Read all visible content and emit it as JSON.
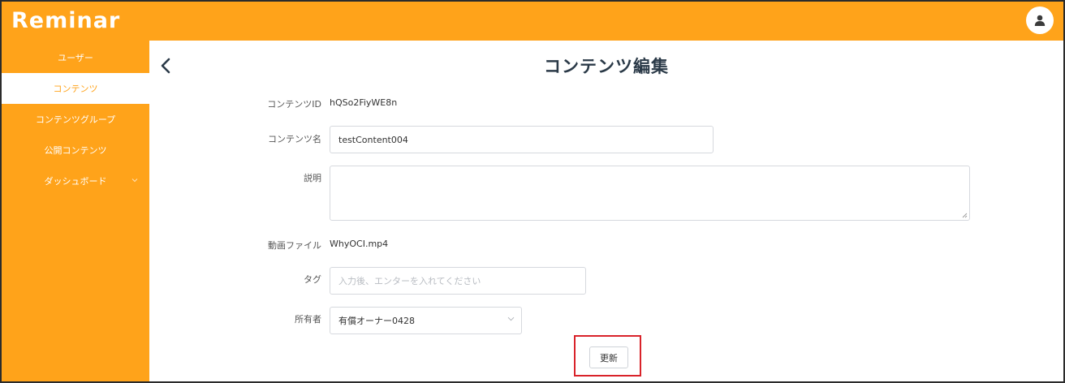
{
  "header": {
    "logo": "Reminar",
    "user_icon": "user-avatar-icon",
    "color": "#ffa31a"
  },
  "sidebar": {
    "items": [
      {
        "label": "ユーザー",
        "active": false
      },
      {
        "label": "コンテンツ",
        "active": true
      },
      {
        "label": "コンテンツグループ",
        "active": false
      },
      {
        "label": "公開コンテンツ",
        "active": false
      },
      {
        "label": "ダッシュボード",
        "active": false,
        "has_submenu": true
      }
    ]
  },
  "main": {
    "title": "コンテンツ編集",
    "back_icon": "chevron-left-icon",
    "form": {
      "content_id_label": "コンテンツID",
      "content_id_value": "hQSo2FiyWE8n",
      "content_name_label": "コンテンツ名",
      "content_name_value": "testContent004",
      "description_label": "説明",
      "description_value": "",
      "video_file_label": "動画ファイル",
      "video_file_value": "WhyOCI.mp4",
      "tag_label": "タグ",
      "tag_placeholder": "入力後、エンターを入れてください",
      "owner_label": "所有者",
      "owner_value": "有償オーナー0428"
    },
    "update_button": "更新",
    "highlight_color": "#d9232a"
  }
}
